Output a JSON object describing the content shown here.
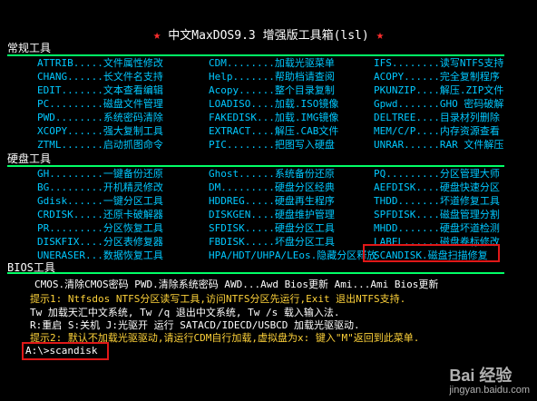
{
  "title": "中文MaxDOS9.3 增强版工具箱(lsl)",
  "sections": {
    "general": "常规工具",
    "disk": "硬盘工具",
    "bios": "BIOS工具"
  },
  "general_rows": [
    [
      "ATTRIB.....文件属性修改",
      "CDM........加载光驱菜单",
      "IFS........读写NTFS支持"
    ],
    [
      "CHANG......长文件名支持",
      "Help.......帮助档请查阅",
      "ACOPY......完全复制程序"
    ],
    [
      "EDIT.......文本查看编辑",
      "Acopy......整个目录复制",
      "PKUNZIP....解压.ZIP文件"
    ],
    [
      "PC.........磁盘文件管理",
      "LOADISO....加载.ISO镜像",
      "Gpwd.......GHO 密码破解"
    ],
    [
      "PWD........系统密码清除",
      "FAKEDISK...加载.IMG镜像",
      "DELTREE....目录材列删除"
    ],
    [
      "XCOPY......强大复制工具",
      "EXTRACT....解压.CAB文件",
      "MEM/C/P....内存资源查看"
    ],
    [
      "ZTML.......启动抓图命令",
      "PIC........把图写入硬盘",
      "UNRAR......RAR 文件解压"
    ]
  ],
  "disk_rows": [
    [
      "GH.........一键备份还原",
      "Ghost......系统备份还原",
      "PQ.........分区管理大师"
    ],
    [
      "BG.........开机精灵修改",
      "DM.........硬盘分区经典",
      "AEFDISK....硬盘快速分区"
    ],
    [
      "Gdisk......一键分区工具",
      "HDDREG.....硬盘再生程序",
      "THDD.......坏道修复工具"
    ],
    [
      "CRDISK.....还原卡破解器",
      "DISKGEN....硬盘维护管理",
      "SPFDISK....磁盘管理分割"
    ],
    [
      "PR.........分区恢复工具",
      "SFDISK.....硬盘分区工具",
      "MHDD.......硬盘坏道检测"
    ],
    [
      "DISKFIX....分区表修复器",
      "FBDISK.....坏盘分区工具",
      "LABEL......磁盘卷标修改"
    ],
    [
      "UNERASER...数据恢复工具",
      "HPA/HDT/UHPA/LEos.隐藏分区释放",
      "SCANDISK.磁盘扫描修复"
    ]
  ],
  "bios_line": "CMOS.清除CMOS密码  PWD.清除系统密码  AWD...Awd Bios更新  Ami...Ami Bios更新",
  "tips": [
    "提示1: Ntfsdos  NTFS分区读写工具,访问NTFS分区先运行,Exit 退出NTFS支持.",
    "  Tw  加载天汇中文系统,  Tw /q 退出中文系统,  Tw /s 载入输入法.",
    "  R:重启   S:关机    J:光驱开   运行 SATACD/IDECD/USBCD 加载光驱驱动.",
    "提示2: 默认不加载光驱驱动,请运行CDM自行加载,虚拟盘为x:  键入\"M\"返回到此菜单."
  ],
  "prompt": "A:\\>scandisk",
  "colors": {
    "accent_green": "#00ff66",
    "key_cyan": "#00c8ff",
    "highlight_red": "#e01818",
    "star_red": "#ff2d2d"
  },
  "icons": {
    "star": "★"
  },
  "watermark": {
    "main": "Bai 经验",
    "sub": "jingyan.baidu.com"
  }
}
